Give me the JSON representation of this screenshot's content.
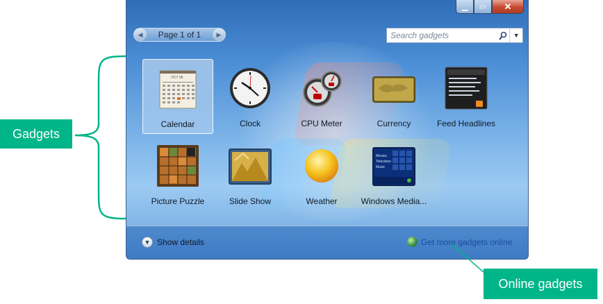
{
  "window": {
    "pager_label": "Page 1 of 1",
    "search_placeholder": "Search gadgets",
    "show_details_label": "Show details",
    "online_link_label": "Get more gadgets online"
  },
  "gadgets": [
    {
      "label": "Calendar",
      "icon": "calendar-icon",
      "selected": true
    },
    {
      "label": "Clock",
      "icon": "clock-icon"
    },
    {
      "label": "CPU Meter",
      "icon": "cpu-meter-icon"
    },
    {
      "label": "Currency",
      "icon": "currency-icon"
    },
    {
      "label": "Feed Headlines",
      "icon": "feed-headlines-icon"
    },
    {
      "label": "Picture Puzzle",
      "icon": "picture-puzzle-icon"
    },
    {
      "label": "Slide Show",
      "icon": "slide-show-icon"
    },
    {
      "label": "Weather",
      "icon": "weather-icon"
    },
    {
      "label": "Windows Media...",
      "icon": "windows-media-center-icon"
    }
  ],
  "calendar_thumb": {
    "month": "OCT 08"
  },
  "media_thumb": {
    "lines": [
      "Movies",
      "Television",
      "Music"
    ]
  },
  "annotations": {
    "gadgets_callout": "Gadgets",
    "online_callout": "Online gadgets"
  },
  "colors": {
    "callout": "#00b588",
    "link": "#1a4ea0"
  }
}
